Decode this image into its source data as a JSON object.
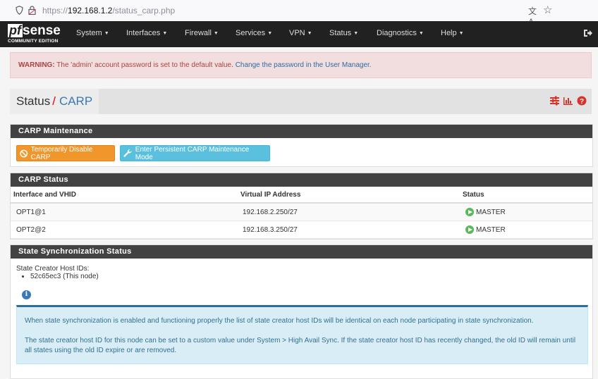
{
  "browser": {
    "url_prefix": "https://",
    "url_host": "192.168.1.2",
    "url_path": "/status_carp.php"
  },
  "navbar": {
    "logo_pf": "pf",
    "logo_sense": "sense",
    "logo_edition": "COMMUNITY EDITION",
    "menu": [
      "System",
      "Interfaces",
      "Firewall",
      "Services",
      "VPN",
      "Status",
      "Diagnostics",
      "Help"
    ]
  },
  "warning": {
    "label": "WARNING:",
    "text": " The 'admin' account password is set to the default value. ",
    "link": "Change the password in the User Manager."
  },
  "breadcrumb": {
    "section": "Status",
    "separator": "/",
    "page": "CARP"
  },
  "maintenance": {
    "title": "CARP Maintenance",
    "disable_button": "Temporarily Disable CARP",
    "persistent_button": "Enter Persistent CARP Maintenance Mode"
  },
  "carp_status": {
    "title": "CARP Status",
    "columns": [
      "Interface and VHID",
      "Virtual IP Address",
      "Status"
    ],
    "rows": [
      {
        "iface": "OPT1@1",
        "vip": "192.168.2.250/27",
        "status": "MASTER"
      },
      {
        "iface": "OPT2@2",
        "vip": "192.168.3.250/27",
        "status": "MASTER"
      }
    ]
  },
  "sync": {
    "title": "State Synchronization Status",
    "label": "State Creator Host IDs:",
    "host_ids": [
      "52c65ec3 (This node)"
    ],
    "info_p1": "When state synchronization is enabled and functioning properly the list of state creator host IDs will be identical on each node participating in state synchronization.",
    "info_p2": "The state creator host ID for this node can be set to a custom value under System > High Avail Sync. If the state creator host ID has recently changed, the old ID will remain until all states using the old ID expire or are removed."
  },
  "colors": {
    "navbar": "#212121",
    "panel_head": "#424242",
    "warning_bg": "#f2dede",
    "warning_text": "#a94442",
    "link": "#2b6ca3",
    "btn_warning": "#f0962b",
    "btn_info": "#5bc0de",
    "status_ok": "#5cb85c",
    "alert_info_bg": "#d9edf7"
  }
}
